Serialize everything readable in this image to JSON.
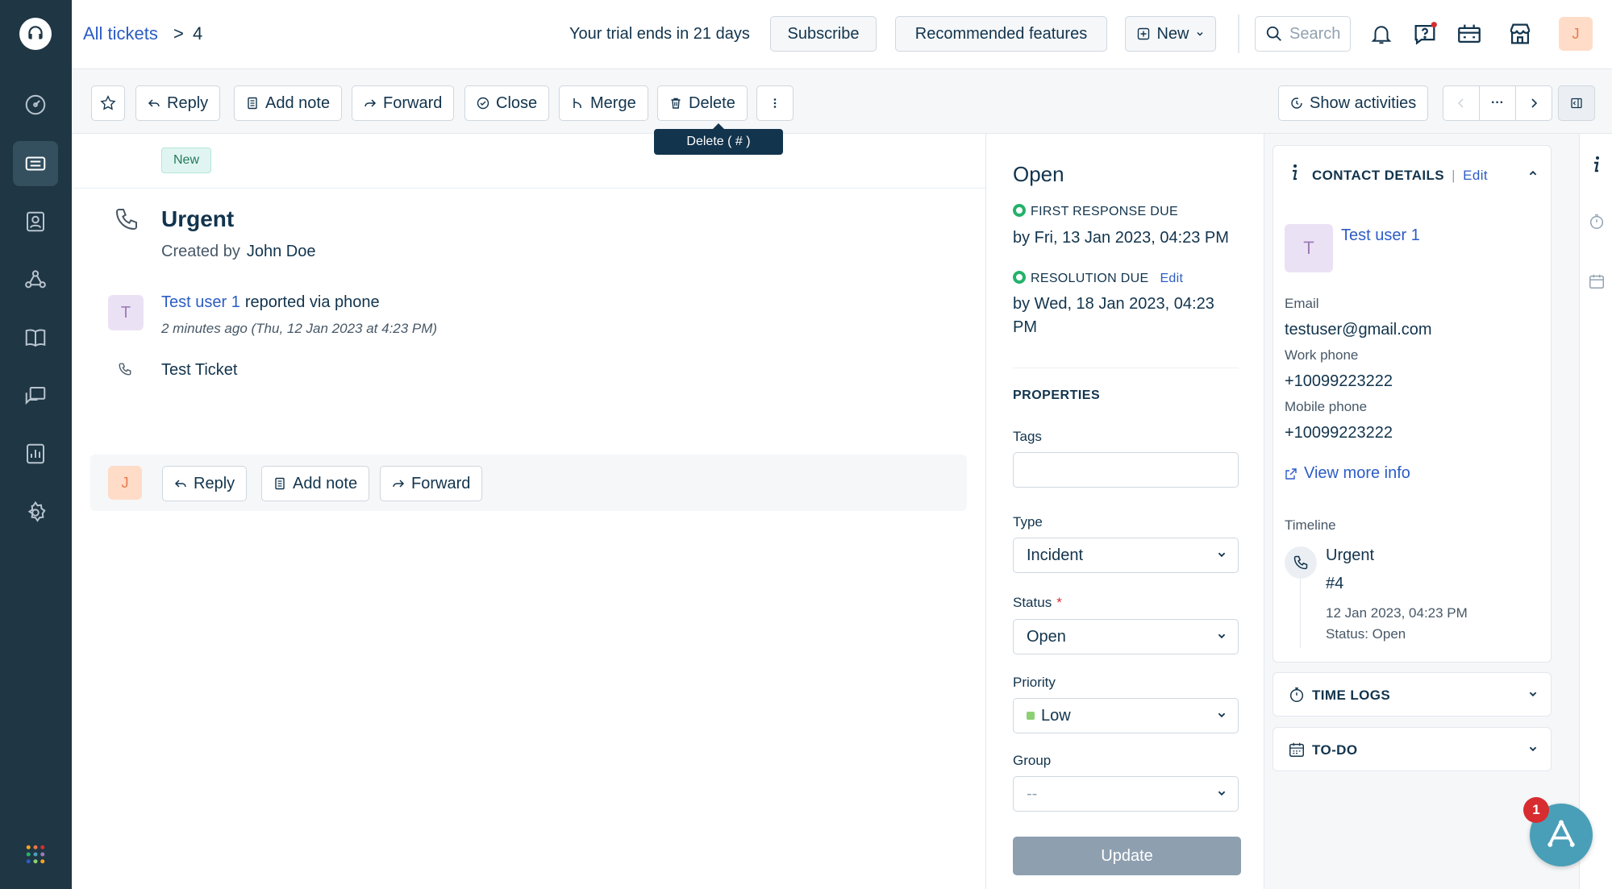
{
  "colors": {
    "rail_bg": "#1f3644",
    "link": "#2c5cc5",
    "sla_green": "#24b26b",
    "priority_low": "#8bd173",
    "badge_red": "#d72d30"
  },
  "breadcrumb": {
    "all_tickets": "All tickets",
    "separator": ">",
    "ticket_number": "4"
  },
  "topbar": {
    "trial_text": "Your trial ends in 21 days",
    "subscribe_label": "Subscribe",
    "recommended_label": "Recommended features",
    "new_label": "New",
    "search_placeholder": "Search",
    "user_initial": "J"
  },
  "toolbar": {
    "reply_label": "Reply",
    "add_note_label": "Add note",
    "forward_label": "Forward",
    "close_label": "Close",
    "merge_label": "Merge",
    "delete_label": "Delete",
    "delete_tooltip": "Delete ( # )",
    "show_activities_label": "Show activities",
    "more_label": "···"
  },
  "ticket": {
    "status_badge": "New",
    "subject": "Urgent",
    "created_by_label": "Created by",
    "created_by": "John Doe",
    "requester_initial": "T",
    "requester_name": "Test user 1",
    "reported_via": "reported via phone",
    "time_ago": "2 minutes ago (Thu, 12 Jan 2023 at 4:23 PM)",
    "body": "Test Ticket"
  },
  "reply_bar": {
    "agent_initial": "J",
    "reply_label": "Reply",
    "add_note_label": "Add note",
    "forward_label": "Forward"
  },
  "properties": {
    "status_heading": "Open",
    "first_response_label": "FIRST RESPONSE DUE",
    "first_response_due": "by Fri, 13 Jan 2023, 04:23 PM",
    "resolution_label": "RESOLUTION DUE",
    "resolution_edit": "Edit",
    "resolution_due": "by Wed, 18 Jan 2023, 04:23 PM",
    "section_label": "PROPERTIES",
    "tags_label": "Tags",
    "tags_value": "",
    "type_label": "Type",
    "type_value": "Incident",
    "status_label": "Status",
    "status_required": "*",
    "status_value": "Open",
    "priority_label": "Priority",
    "priority_value": "Low",
    "group_label": "Group",
    "group_value": "--",
    "update_label": "Update"
  },
  "contact": {
    "title": "CONTACT DETAILS",
    "separator": "|",
    "edit_label": "Edit",
    "initial": "T",
    "name": "Test user 1",
    "email_label": "Email",
    "email": "testuser@gmail.com",
    "work_phone_label": "Work phone",
    "work_phone": "+10099223222",
    "mobile_phone_label": "Mobile phone",
    "mobile_phone": "+10099223222",
    "view_more_label": "View more info",
    "timeline_label": "Timeline",
    "timeline_subject": "Urgent",
    "timeline_id": "#4",
    "timeline_date": "12 Jan 2023, 04:23 PM",
    "timeline_status": "Status: Open"
  },
  "time_logs": {
    "title": "TIME LOGS"
  },
  "todo": {
    "title": "TO-DO"
  },
  "chat": {
    "unread_count": "1"
  }
}
